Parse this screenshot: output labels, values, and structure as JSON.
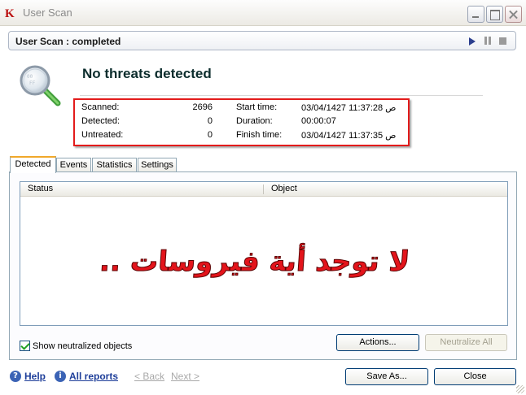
{
  "window": {
    "title": "User Scan",
    "logo_letter": "K"
  },
  "status_bar": {
    "text": "User Scan : completed"
  },
  "result": {
    "headline": "No threats detected"
  },
  "summary": {
    "rows": [
      {
        "label": "Scanned:",
        "count": "2696",
        "time_label": "Start time:",
        "time_value": "03/04/1427 11:37:28 ص"
      },
      {
        "label": "Detected:",
        "count": "0",
        "time_label": "Duration:",
        "time_value": "00:00:07"
      },
      {
        "label": "Untreated:",
        "count": "0",
        "time_label": "Finish time:",
        "time_value": "03/04/1427 11:37:35 ص"
      }
    ],
    "highlight_color": "#e31b1b"
  },
  "tabs": [
    {
      "label": "Detected",
      "active": true
    },
    {
      "label": "Events",
      "active": false
    },
    {
      "label": "Statistics",
      "active": false
    },
    {
      "label": "Settings",
      "active": false
    }
  ],
  "list": {
    "columns": [
      "Status",
      "Object"
    ],
    "annotation": "لا توجد أية فيروسات .."
  },
  "options": {
    "show_neutralized_label": "Show neutralized objects",
    "show_neutralized_checked": true
  },
  "buttons": {
    "actions": "Actions...",
    "neutralize_all": "Neutralize All",
    "save_as": "Save As...",
    "close": "Close"
  },
  "footer": {
    "help": "Help",
    "all_reports": "All reports",
    "back": "< Back",
    "next": "Next >"
  },
  "colors": {
    "accent_blue": "#1f3f9a",
    "headline": "#0c2d2d",
    "annotation_red": "#e3141b",
    "tab_highlight": "#f0a82a"
  }
}
